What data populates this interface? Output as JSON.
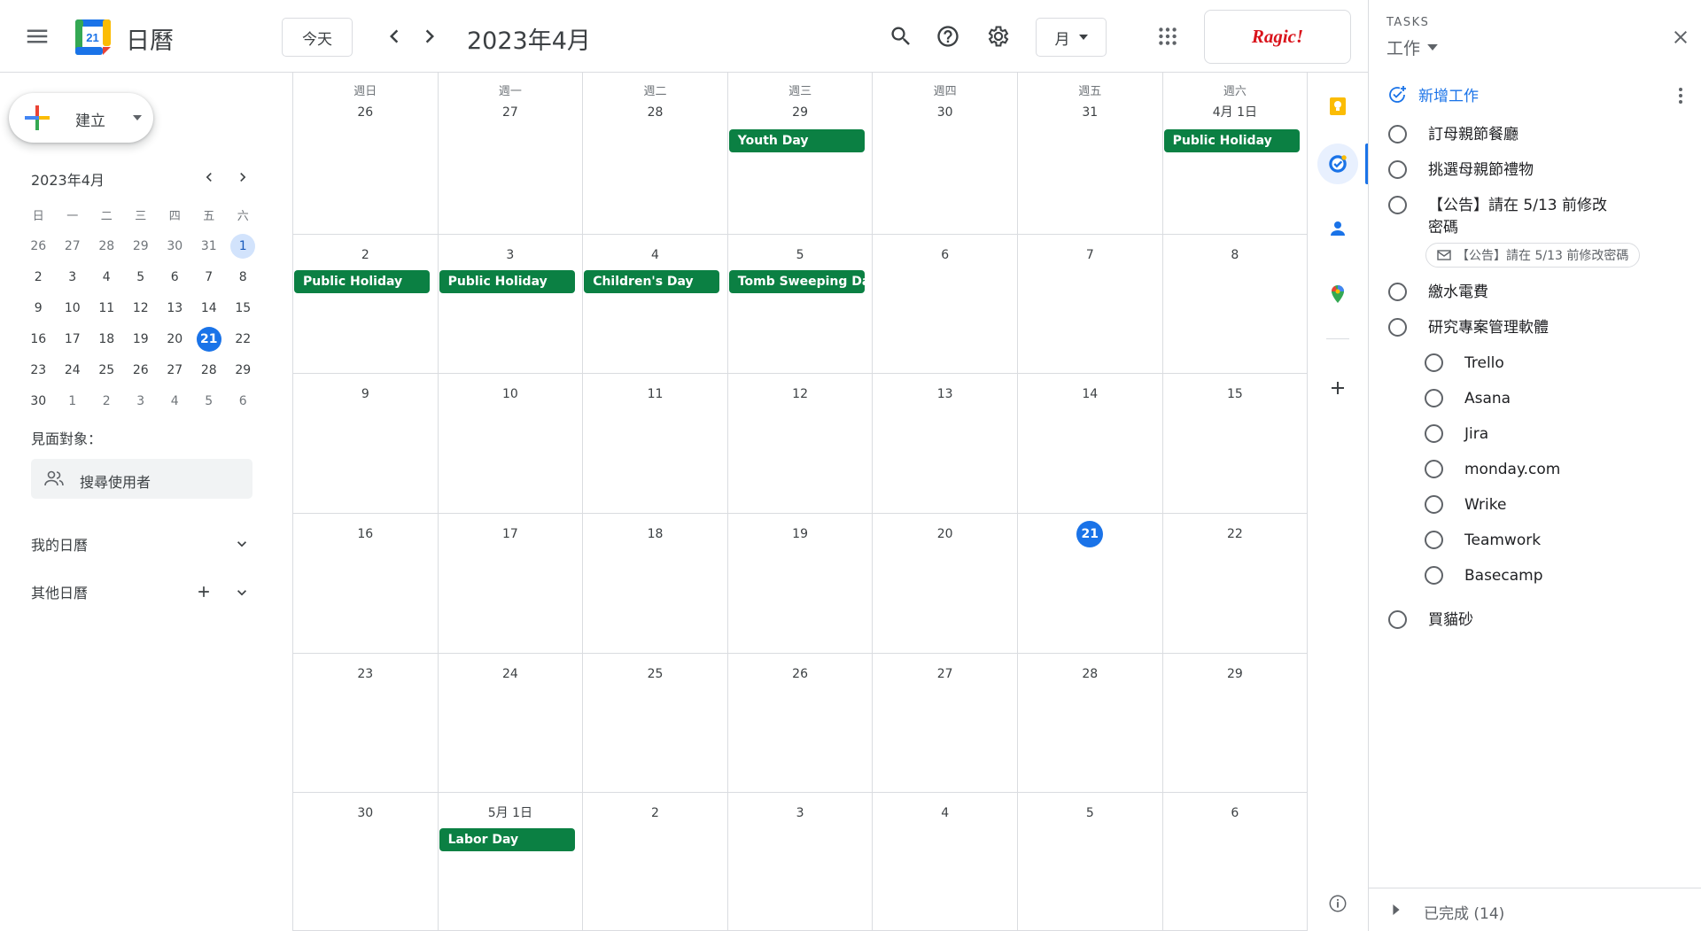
{
  "header": {
    "app_title": "日曆",
    "logo_day": "21",
    "today_label": "今天",
    "period_title": "2023年4月",
    "view_label": "月",
    "ragic_label": "Ragic!"
  },
  "sidebar": {
    "create_label": "建立",
    "mini_title": "2023年4月",
    "weekdays": [
      "日",
      "一",
      "二",
      "三",
      "四",
      "五",
      "六"
    ],
    "weeks": [
      [
        "26",
        "27",
        "28",
        "29",
        "30",
        "31",
        "1"
      ],
      [
        "2",
        "3",
        "4",
        "5",
        "6",
        "7",
        "8"
      ],
      [
        "9",
        "10",
        "11",
        "12",
        "13",
        "14",
        "15"
      ],
      [
        "16",
        "17",
        "18",
        "19",
        "20",
        "21",
        "22"
      ],
      [
        "23",
        "24",
        "25",
        "26",
        "27",
        "28",
        "29"
      ],
      [
        "30",
        "1",
        "2",
        "3",
        "4",
        "5",
        "6"
      ]
    ],
    "meet_label": "見面對象：",
    "search_users_placeholder": "搜尋使用者",
    "my_calendars": "我的日曆",
    "other_calendars": "其他日曆"
  },
  "month": {
    "weekday_headers": [
      "週日",
      "週一",
      "週二",
      "週三",
      "週四",
      "週五",
      "週六"
    ],
    "weeks": [
      [
        "26",
        "27",
        "28",
        "29",
        "30",
        "31",
        "4月 1日"
      ],
      [
        "2",
        "3",
        "4",
        "5",
        "6",
        "7",
        "8"
      ],
      [
        "9",
        "10",
        "11",
        "12",
        "13",
        "14",
        "15"
      ],
      [
        "16",
        "17",
        "18",
        "19",
        "20",
        "21",
        "22"
      ],
      [
        "23",
        "24",
        "25",
        "26",
        "27",
        "28",
        "29"
      ],
      [
        "30",
        "5月 1日",
        "2",
        "3",
        "4",
        "5",
        "6"
      ]
    ],
    "today": "21",
    "events": [
      {
        "week": 0,
        "day": 3,
        "title": "Youth Day"
      },
      {
        "week": 0,
        "day": 6,
        "title": "Public Holiday"
      },
      {
        "week": 1,
        "day": 0,
        "title": "Public Holiday"
      },
      {
        "week": 1,
        "day": 1,
        "title": "Public Holiday"
      },
      {
        "week": 1,
        "day": 2,
        "title": "Children's Day"
      },
      {
        "week": 1,
        "day": 3,
        "title": "Tomb Sweeping Day"
      },
      {
        "week": 5,
        "day": 1,
        "title": "Labor Day"
      }
    ],
    "event_color": "#0b8043"
  },
  "tasks": {
    "panel_label": "TASKS",
    "list_name": "工作",
    "add_task_label": "新增工作",
    "items": [
      {
        "title": "訂母親節餐廳"
      },
      {
        "title": "挑選母親節禮物"
      },
      {
        "title": "【公告】請在 5/13 前修改密碼",
        "line1": "【公告】請在 5/13 前修改",
        "line2": "密碼",
        "link": "【公告】請在 5/13 前修改密碼"
      },
      {
        "title": "繳水電費"
      },
      {
        "title": "研究專案管理軟體",
        "subtasks": [
          "Trello",
          "Asana",
          "Jira",
          "monday.com",
          "Wrike",
          "Teamwork",
          "Basecamp"
        ]
      },
      {
        "title": "買貓砂"
      }
    ],
    "completed_label": "已完成 (14)"
  },
  "colors": {
    "accent": "#1a73e8",
    "event_green": "#0b8043",
    "today_highlight": "#d2e3fc"
  }
}
